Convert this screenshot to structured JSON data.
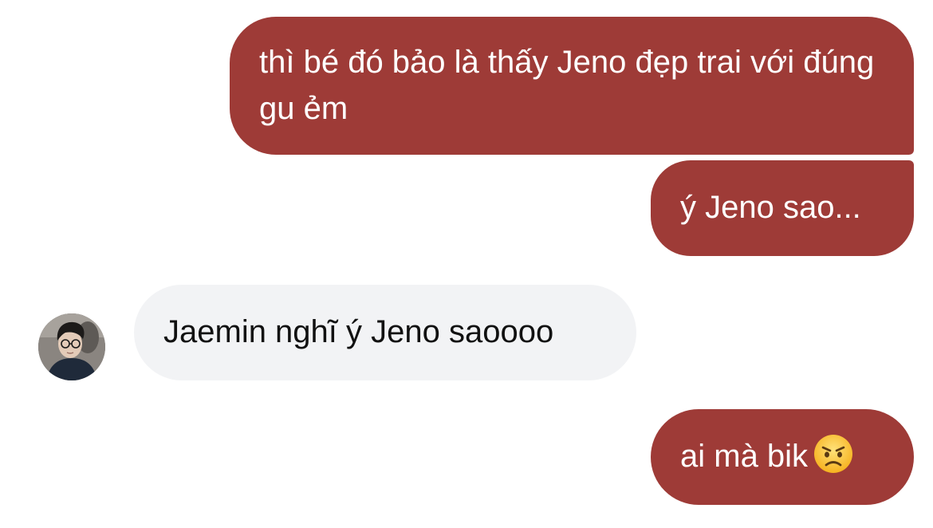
{
  "conversation": {
    "messages": [
      {
        "sender": "me",
        "text": "thì bé đó bảo là thấy Jeno đẹp trai với đúng gu ẻm"
      },
      {
        "sender": "me",
        "text": "ý Jeno sao..."
      },
      {
        "sender": "other",
        "text": "Jaemin nghĩ ý Jeno saoooo"
      },
      {
        "sender": "me",
        "text": "ai mà bik",
        "emoji": "angry-face-emoji"
      }
    ]
  },
  "colors": {
    "outgoing_bubble": "#9e3b37",
    "incoming_bubble": "#f2f3f5",
    "outgoing_text": "#ffffff",
    "incoming_text": "#111111"
  },
  "icons": {
    "avatar": "contact-avatar-photo",
    "emoji": "angry-face-emoji"
  }
}
